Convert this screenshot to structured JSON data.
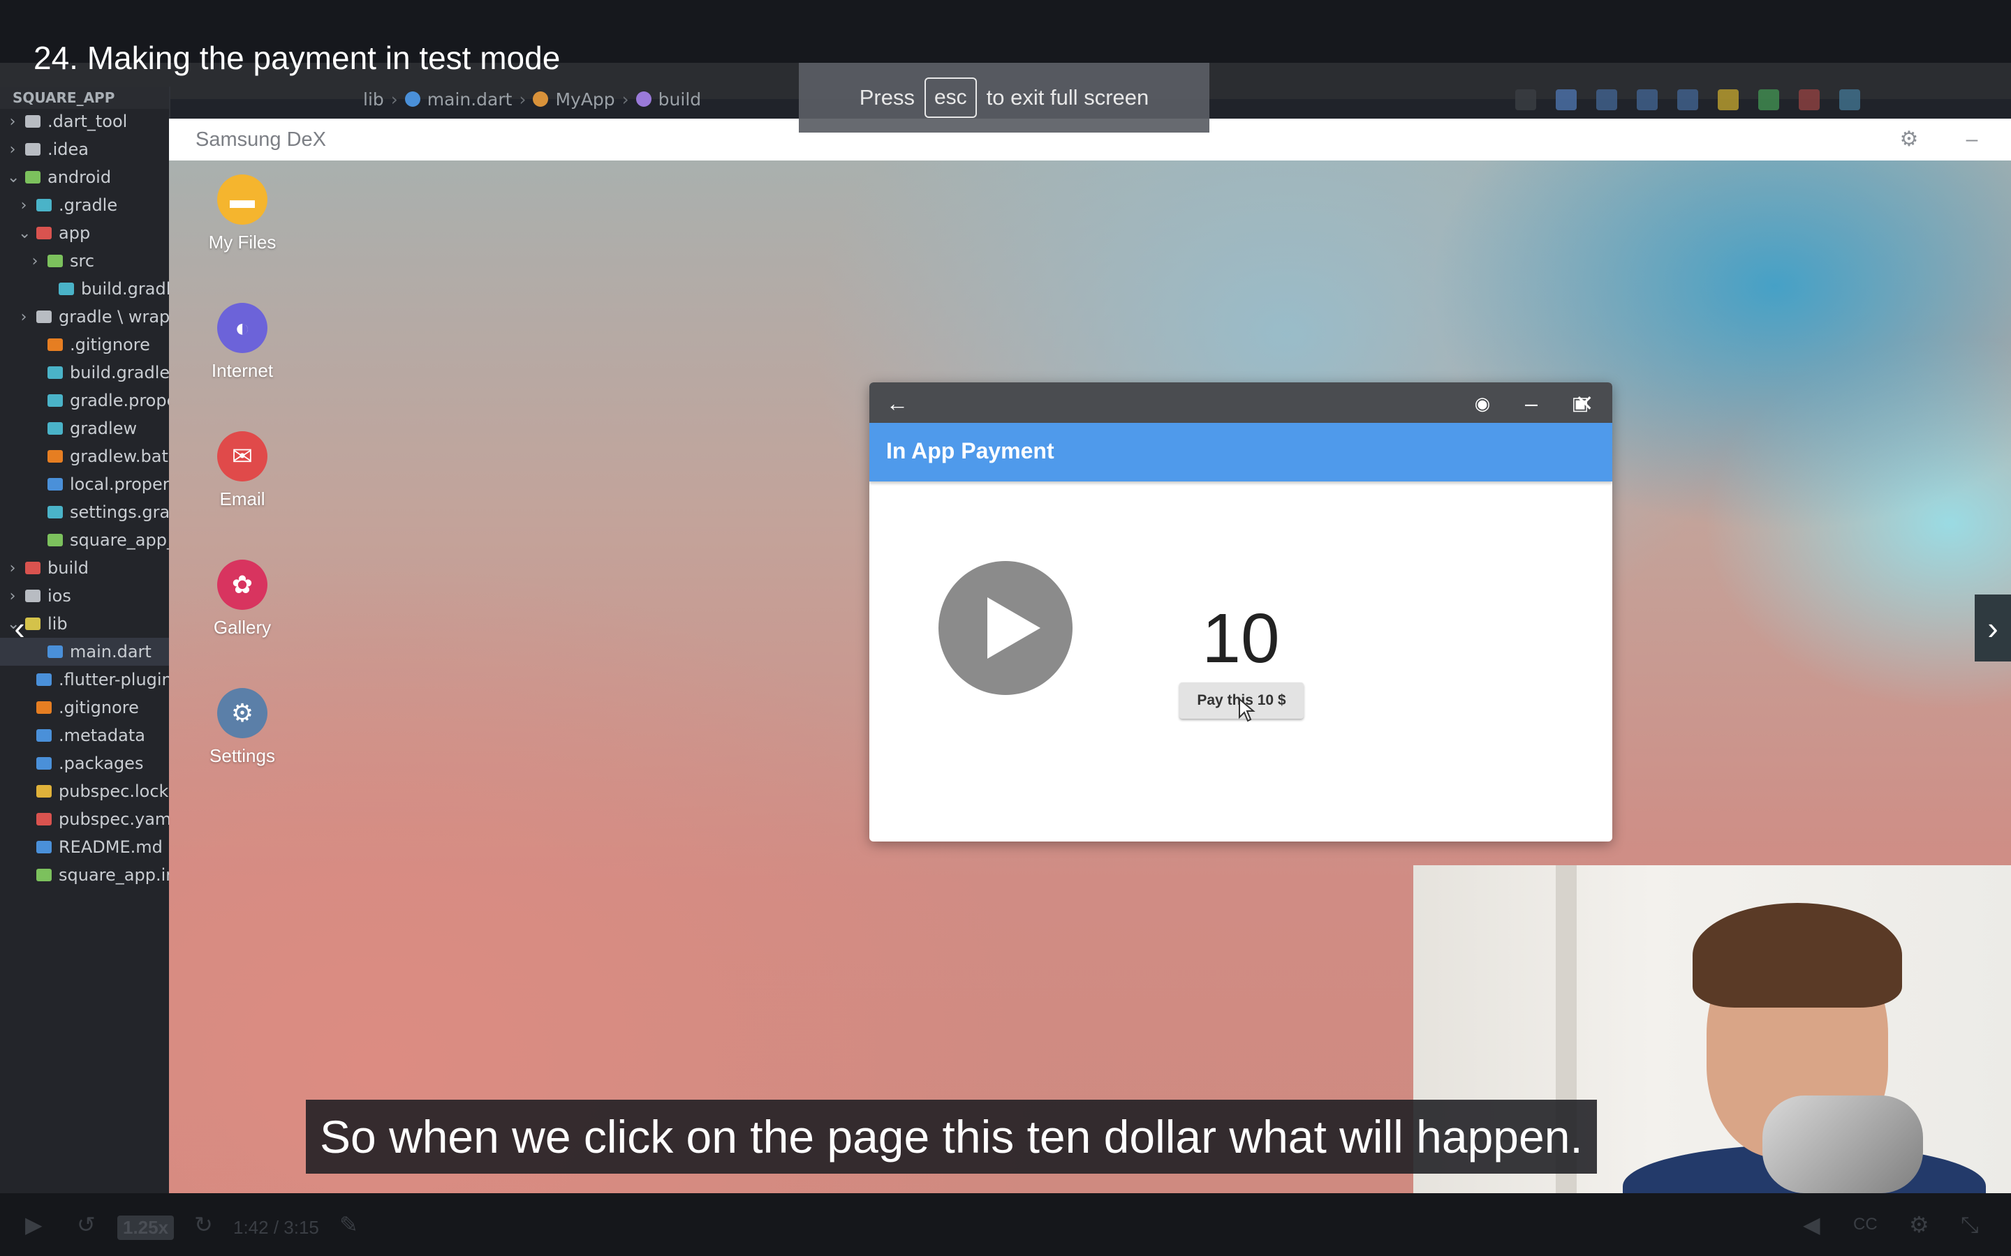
{
  "course": {
    "lecture_title": "24. Making the payment in test mode"
  },
  "fullscreen_toast": {
    "press": "Press",
    "key": "esc",
    "suffix": "to exit full screen"
  },
  "ide": {
    "breadcrumbs": [
      "lib",
      "main.dart",
      "MyApp",
      "build"
    ],
    "project_title": "SQUARE_APP",
    "tree": [
      {
        "label": ".dart_tool",
        "level": 0,
        "chev": "›",
        "color": "#b8bcc2"
      },
      {
        "label": ".idea",
        "level": 0,
        "chev": "›",
        "color": "#b8bcc2"
      },
      {
        "label": "android",
        "level": 0,
        "chev": "⌄",
        "color": "#7cc15d"
      },
      {
        "label": ".gradle",
        "level": 1,
        "chev": "›",
        "color": "#4ab3c8"
      },
      {
        "label": "app",
        "level": 1,
        "chev": "⌄",
        "color": "#d9534f"
      },
      {
        "label": "src",
        "level": 2,
        "chev": "›",
        "color": "#7cc15d"
      },
      {
        "label": "build.gradle",
        "level": 3,
        "chev": "",
        "color": "#4ab3c8"
      },
      {
        "label": "gradle \\ wrapp",
        "level": 1,
        "chev": "›",
        "color": "#b8bcc2"
      },
      {
        "label": ".gitignore",
        "level": 2,
        "chev": "",
        "color": "#e67e22"
      },
      {
        "label": "build.gradle",
        "level": 2,
        "chev": "",
        "color": "#4ab3c8"
      },
      {
        "label": "gradle.propert",
        "level": 2,
        "chev": "",
        "color": "#4ab3c8"
      },
      {
        "label": "gradlew",
        "level": 2,
        "chev": "",
        "color": "#4ab3c8"
      },
      {
        "label": "gradlew.bat",
        "level": 2,
        "chev": "",
        "color": "#e67e22"
      },
      {
        "label": "local.propertie",
        "level": 2,
        "chev": "",
        "color": "#4a90d9"
      },
      {
        "label": "settings.gradle",
        "level": 2,
        "chev": "",
        "color": "#4ab3c8"
      },
      {
        "label": "square_app_a",
        "level": 2,
        "chev": "",
        "color": "#7cc15d"
      },
      {
        "label": "build",
        "level": 0,
        "chev": "›",
        "color": "#d9534f"
      },
      {
        "label": "ios",
        "level": 0,
        "chev": "›",
        "color": "#b8bcc2"
      },
      {
        "label": "lib",
        "level": 0,
        "chev": "⌄",
        "color": "#d4c24a"
      },
      {
        "label": "main.dart",
        "level": 2,
        "chev": "",
        "color": "#4a90d9",
        "selected": true
      },
      {
        "label": ".flutter-plugins",
        "level": 1,
        "chev": "",
        "color": "#4a90d9"
      },
      {
        "label": ".gitignore",
        "level": 1,
        "chev": "",
        "color": "#e67e22"
      },
      {
        "label": ".metadata",
        "level": 1,
        "chev": "",
        "color": "#4a90d9"
      },
      {
        "label": ".packages",
        "level": 1,
        "chev": "",
        "color": "#4a90d9"
      },
      {
        "label": "pubspec.lock",
        "level": 1,
        "chev": "",
        "color": "#e0b23a"
      },
      {
        "label": "pubspec.yaml",
        "level": 1,
        "chev": "",
        "color": "#d9534f"
      },
      {
        "label": "README.md",
        "level": 1,
        "chev": "",
        "color": "#4a90d9"
      },
      {
        "label": "square_app.iml",
        "level": 1,
        "chev": "",
        "color": "#7cc15d"
      }
    ]
  },
  "dex": {
    "title": "Samsung DeX",
    "desktop_icons": [
      {
        "label": "My Files",
        "icon": "folder-icon",
        "color": "#f5b52e"
      },
      {
        "label": "Internet",
        "icon": "globe-icon",
        "color": "#6c63d9"
      },
      {
        "label": "Email",
        "icon": "envelope-icon",
        "color": "#e04a4a"
      },
      {
        "label": "Gallery",
        "icon": "flower-icon",
        "color": "#d8345f"
      },
      {
        "label": "Settings",
        "icon": "gear-icon",
        "color": "#5b7fa8"
      }
    ]
  },
  "app": {
    "title": "In App Payment",
    "amount": "10",
    "pay_button": "Pay this 10 $",
    "accent": "#4f9aeb"
  },
  "subtitle": "So when we click on the page this ten dollar what will happen.",
  "controls": {
    "speed": "1.25x",
    "time": "1:42 / 3:15"
  }
}
